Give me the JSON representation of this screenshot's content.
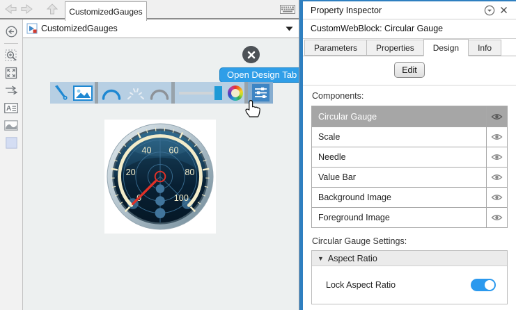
{
  "tabbar": {
    "tab": "CustomizedGauges"
  },
  "breadcrumb": {
    "model": "CustomizedGauges"
  },
  "canvas": {
    "tooltip": "Open Design Tab"
  },
  "inspector": {
    "title": "Property Inspector",
    "subtitle": "CustomWebBlock: Circular Gauge",
    "tabs": [
      {
        "label": "Parameters",
        "active": false
      },
      {
        "label": "Properties",
        "active": false
      },
      {
        "label": "Design",
        "active": true
      },
      {
        "label": "Info",
        "active": false
      }
    ],
    "edit_label": "Edit",
    "components_label": "Components:",
    "components": [
      {
        "label": "Circular Gauge",
        "selected": true
      },
      {
        "label": "Scale",
        "selected": false
      },
      {
        "label": "Needle",
        "selected": false
      },
      {
        "label": "Value Bar",
        "selected": false
      },
      {
        "label": "Background Image",
        "selected": false
      },
      {
        "label": "Foreground Image",
        "selected": false
      }
    ],
    "settings_label": "Circular Gauge Settings:",
    "aspect_section": "Aspect Ratio",
    "lock_label": "Lock Aspect Ratio",
    "lock_on": true
  },
  "gauge": {
    "min": 0,
    "max": 100,
    "value": 0,
    "tick_labels": [
      "0",
      "20",
      "40",
      "60",
      "80",
      "100"
    ],
    "minor_ticks": 4,
    "start_angle_deg": 225,
    "end_angle_deg": -45,
    "colors": {
      "scale": "#f3ecca",
      "needle": "#e23127",
      "rings": "#3b6f94",
      "dots": "#41759c",
      "face_top": "#266084",
      "face_bottom": "#081c2c"
    }
  },
  "colors": {
    "accent_blue": "#2e7fc0",
    "tooltip_blue": "#2f9ee8",
    "toolbar_bg": "#b7cfe3",
    "toggle_on": "#2b99ee",
    "selected_row_gray": "#a6a6a6"
  }
}
